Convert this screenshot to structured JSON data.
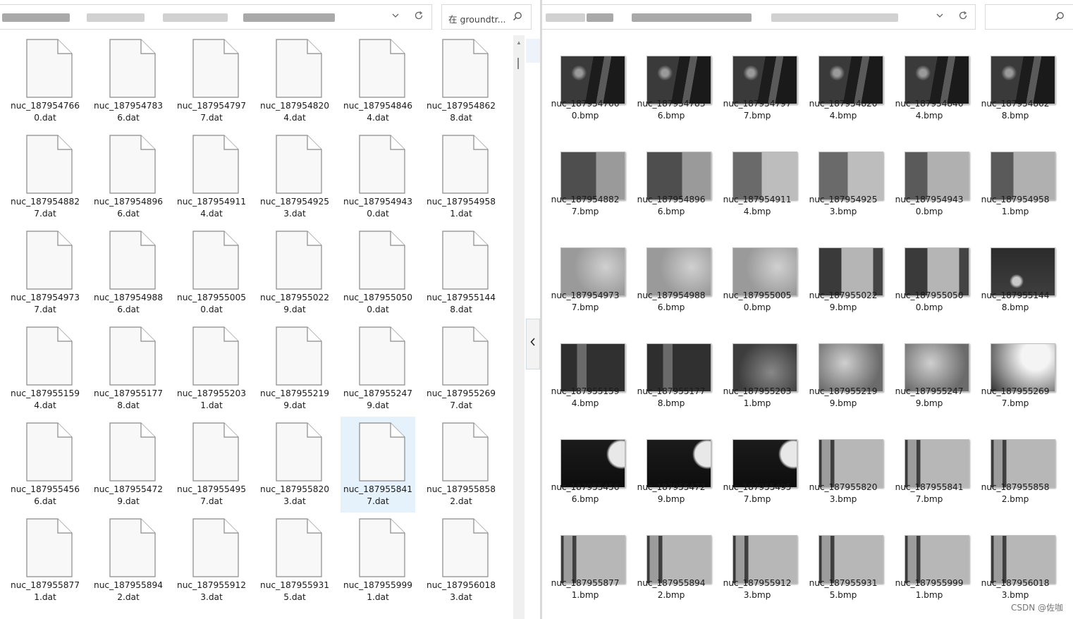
{
  "left_window": {
    "search_placeholder": "在 groundtr...",
    "files": [
      [
        "nuc_187954766\n0.dat",
        "nuc_187954783\n6.dat",
        "nuc_187954797\n7.dat",
        "nuc_187954820\n4.dat",
        "nuc_187954846\n4.dat",
        "nuc_187954862\n8.dat"
      ],
      [
        "nuc_187954882\n7.dat",
        "nuc_187954896\n6.dat",
        "nuc_187954911\n4.dat",
        "nuc_187954925\n3.dat",
        "nuc_187954943\n0.dat",
        "nuc_187954958\n1.dat"
      ],
      [
        "nuc_187954973\n7.dat",
        "nuc_187954988\n6.dat",
        "nuc_187955005\n0.dat",
        "nuc_187955022\n9.dat",
        "nuc_187955050\n0.dat",
        "nuc_187955144\n8.dat"
      ],
      [
        "nuc_187955159\n4.dat",
        "nuc_187955177\n8.dat",
        "nuc_187955203\n1.dat",
        "nuc_187955219\n9.dat",
        "nuc_187955247\n9.dat",
        "nuc_187955269\n7.dat"
      ],
      [
        "nuc_187955456\n6.dat",
        "nuc_187955472\n9.dat",
        "nuc_187955495\n7.dat",
        "nuc_187955820\n3.dat",
        "nuc_187955841\n7.dat",
        "nuc_187955858\n2.dat"
      ],
      [
        "nuc_187955877\n1.dat",
        "nuc_187955894\n2.dat",
        "nuc_187955912\n3.dat",
        "nuc_187955931\n5.dat",
        "nuc_187955999\n1.dat",
        "nuc_187956018\n3.dat"
      ]
    ],
    "selected": "nuc_187955841\n7.dat"
  },
  "right_window": {
    "files": [
      [
        "nuc_187954766\n0.bmp",
        "nuc_187954783\n6.bmp",
        "nuc_187954797\n7.bmp",
        "nuc_187954820\n4.bmp",
        "nuc_187954846\n4.bmp",
        "nuc_187954862\n8.bmp"
      ],
      [
        "nuc_187954882\n7.bmp",
        "nuc_187954896\n6.bmp",
        "nuc_187954911\n4.bmp",
        "nuc_187954925\n3.bmp",
        "nuc_187954943\n0.bmp",
        "nuc_187954958\n1.bmp"
      ],
      [
        "nuc_187954973\n7.bmp",
        "nuc_187954988\n6.bmp",
        "nuc_187955005\n0.bmp",
        "nuc_187955022\n9.bmp",
        "nuc_187955050\n0.bmp",
        "nuc_187955144\n8.bmp"
      ],
      [
        "nuc_187955159\n4.bmp",
        "nuc_187955177\n8.bmp",
        "nuc_187955203\n1.bmp",
        "nuc_187955219\n9.bmp",
        "nuc_187955247\n9.bmp",
        "nuc_187955269\n7.bmp"
      ],
      [
        "nuc_187955456\n6.bmp",
        "nuc_187955472\n9.bmp",
        "nuc_187955495\n7.bmp",
        "nuc_187955820\n3.bmp",
        "nuc_187955841\n7.bmp",
        "nuc_187955858\n2.bmp"
      ],
      [
        "nuc_187955877\n1.bmp",
        "nuc_187955894\n2.bmp",
        "nuc_187955912\n3.bmp",
        "nuc_187955931\n5.bmp",
        "nuc_187955999\n1.bmp",
        "nuc_187956018\n3.bmp"
      ]
    ],
    "thumb_style": [
      [
        "dark-wall",
        "dark-wall",
        "dark-wall",
        "dark-wall",
        "dark-wall",
        "dark-wall"
      ],
      [
        "box-left",
        "box-left",
        "box-mid",
        "box-mid",
        "box-right",
        "box-right"
      ],
      [
        "light-box",
        "light-box",
        "light-box",
        "box-dark",
        "box-dark",
        "dark-ball"
      ],
      [
        "dark-rail",
        "dark-rail",
        "blur-mid",
        "blur-light",
        "blur-light",
        "bright-fog"
      ],
      [
        "black-ball",
        "black-ball",
        "black-ball",
        "board",
        "board",
        "board"
      ],
      [
        "board",
        "board",
        "board",
        "board",
        "board",
        "board"
      ]
    ]
  },
  "watermark": "CSDN @佐咖",
  "icons": {
    "dropdown": "chevron-down-icon",
    "refresh": "refresh-icon",
    "search": "search-icon",
    "collapse": "chevron-left-icon"
  }
}
